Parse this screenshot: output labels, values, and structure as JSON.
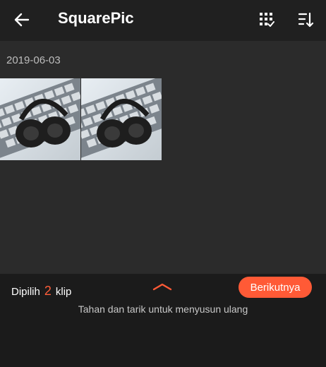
{
  "header": {
    "title": "SquarePic",
    "back_icon": "arrow-left-icon",
    "select_icon": "select-all-grid-icon",
    "sort_icon": "sort-icon"
  },
  "gallery": {
    "date": "2019-06-03",
    "items": [
      {
        "subject": "headphones-on-keyboard",
        "selected": true
      },
      {
        "subject": "headphones-on-keyboard",
        "selected": true
      }
    ]
  },
  "footer": {
    "selected_prefix": "Dipilih",
    "selected_count": "2",
    "selected_suffix": "klip",
    "next_label": "Berikutnya",
    "hint": "Tahan dan tarik untuk menyusun ulang",
    "expand_icon": "chevron-up-icon"
  },
  "colors": {
    "accent": "#ff5a36",
    "header_bg": "#202020",
    "content_bg": "#2b2b2b",
    "footer_bg": "#1b1b1b"
  }
}
